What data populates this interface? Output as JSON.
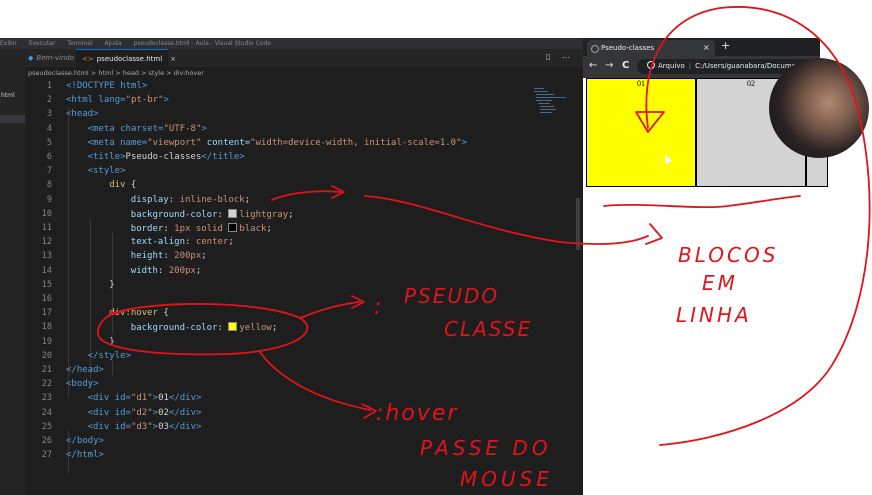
{
  "editor": {
    "titlebar_items": [
      "Exibir",
      "Executar",
      "Terminal",
      "Ajuda",
      "pseudoclasse.html - Aula - Visual Studio Code"
    ],
    "tabs": [
      {
        "label": "Bem-vindo"
      },
      {
        "label": "pseudoclasse.html",
        "close": "×"
      }
    ],
    "sidebar_label": "html",
    "breadcrumb": "pseudoclasse.html > html > head > style > div:hover",
    "lines": [
      {
        "n": "1"
      },
      {
        "n": "2"
      },
      {
        "n": "3"
      },
      {
        "n": "4"
      },
      {
        "n": "5"
      },
      {
        "n": "6"
      },
      {
        "n": "7"
      },
      {
        "n": "8"
      },
      {
        "n": "9"
      },
      {
        "n": "10"
      },
      {
        "n": "11"
      },
      {
        "n": "12"
      },
      {
        "n": "13"
      },
      {
        "n": "14"
      },
      {
        "n": "15"
      },
      {
        "n": "16"
      },
      {
        "n": "17"
      },
      {
        "n": "18"
      },
      {
        "n": "19"
      },
      {
        "n": "20"
      },
      {
        "n": "21"
      },
      {
        "n": "22"
      },
      {
        "n": "23"
      },
      {
        "n": "24"
      },
      {
        "n": "25"
      },
      {
        "n": "26"
      },
      {
        "n": "27"
      }
    ],
    "code": {
      "l1": "<!DOCTYPE html>",
      "l2_a": "<html lang=",
      "l2_b": "\"pt-br\"",
      "l2_c": ">",
      "l3": "<head>",
      "l4_a": "<meta charset=",
      "l4_b": "\"UTF-8\"",
      "l4_c": ">",
      "l5_a": "<meta name=",
      "l5_b": "\"viewport\"",
      "l5_c": " content=",
      "l5_d": "\"width=device-width, initial-scale=1.0\"",
      "l5_e": ">",
      "l6_a": "<title>",
      "l6_b": "Pseudo-classes",
      "l6_c": "</title>",
      "l7": "<style>",
      "l8_a": "div",
      "l8_b": " {",
      "l9_a": "display",
      "l9_b": ": ",
      "l9_c": "inline-block",
      "l9_d": ";",
      "l10_a": "background-color",
      "l10_b": ": ",
      "l10_c": "lightgray",
      "l10_d": ";",
      "l11_a": "border",
      "l11_b": ": ",
      "l11_c": "1px solid ",
      "l11_d": "black",
      "l11_e": ";",
      "l12_a": "text-align",
      "l12_b": ": ",
      "l12_c": "center",
      "l12_d": ";",
      "l13_a": "height",
      "l13_b": ": ",
      "l13_c": "200px",
      "l13_d": ";",
      "l14_a": "width",
      "l14_b": ": ",
      "l14_c": "200px",
      "l14_d": ";",
      "l15": "}",
      "l17_a": "div:hover",
      "l17_b": " {",
      "l18_a": "background-color",
      "l18_b": ": ",
      "l18_c": "yellow",
      "l18_d": ";",
      "l19": "}",
      "l20": "</style>",
      "l21": "</head>",
      "l22": "<body>",
      "l23_a": "<div id=",
      "l23_b": "\"d1\"",
      "l23_c": ">",
      "l23_d": "01",
      "l23_e": "</div>",
      "l24_a": "<div id=",
      "l24_b": "\"d2\"",
      "l24_c": ">",
      "l24_d": "02",
      "l24_e": "</div>",
      "l25_a": "<div id=",
      "l25_b": "\"d3\"",
      "l25_c": ">",
      "l25_d": "03",
      "l25_e": "</div>",
      "l26": "</body>",
      "l27": "</html>"
    },
    "swatches": {
      "lightgray": "#d3d3d3",
      "black": "#000000",
      "yellow": "#ffff00"
    }
  },
  "browser": {
    "tab_title": "Pseudo-classes",
    "tab_close": "×",
    "new_tab": "+",
    "nav": {
      "back": "←",
      "forward": "→",
      "reload": "C"
    },
    "address_label": "Arquivo",
    "address_path": "C:/Users/guanabara/Documen",
    "boxes": [
      {
        "label": "01",
        "color": "#ffff00"
      },
      {
        "label": "02",
        "color": "#d3d3d3"
      },
      {
        "label": "03",
        "color": "#d3d3d3"
      }
    ]
  },
  "annotations": {
    "color": "#e0141a",
    "pseudo_1": "PSEUDO",
    "pseudo_2": "CLASSE",
    "colon": ":",
    "hover": ":hover",
    "passe_1": "PASSE DO",
    "passe_2": "MOUSE",
    "blocos_1": "BLOCOS",
    "blocos_2": "EM",
    "blocos_3": "LINHA"
  }
}
